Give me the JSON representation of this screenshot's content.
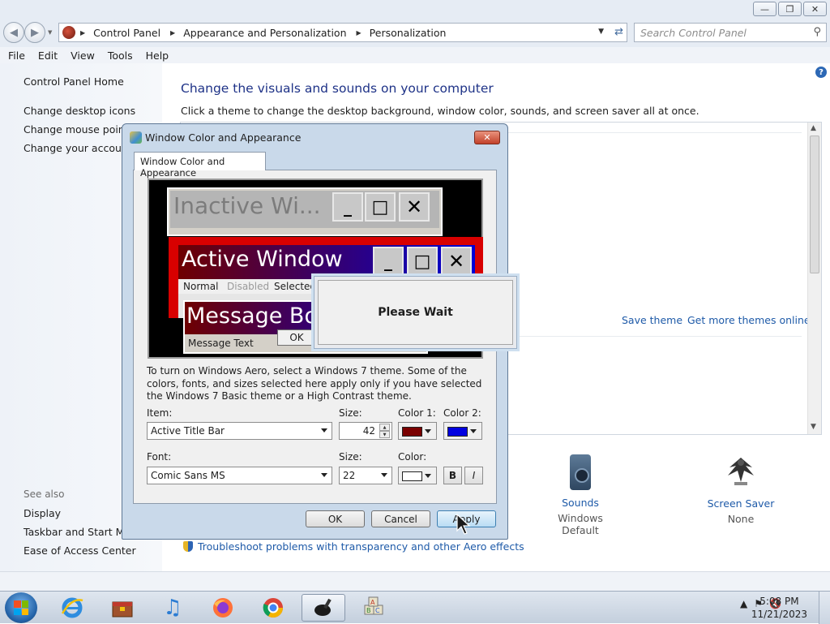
{
  "nav": {
    "breadcrumbs": [
      "Control Panel",
      "Appearance and Personalization",
      "Personalization"
    ],
    "search_placeholder": "Search Control Panel"
  },
  "menu": [
    "File",
    "Edit",
    "View",
    "Tools",
    "Help"
  ],
  "sidebar": {
    "home": "Control Panel Home",
    "links": [
      "Change desktop icons",
      "Change mouse pointers",
      "Change your account picture"
    ],
    "see_also_label": "See also",
    "see_also": [
      "Display",
      "Taskbar and Start Menu",
      "Ease of Access Center"
    ]
  },
  "main": {
    "heading": "Change the visuals and sounds on your computer",
    "subtext": "Click a theme to change the desktop background, window color, sounds, and screen saver all at once.",
    "save_theme": "Save theme",
    "get_more": "Get more themes online",
    "sounds_label": "Sounds",
    "sounds_value": "Windows Default",
    "saver_label": "Screen Saver",
    "saver_value": "None",
    "trouble_link": "Troubleshoot problems with transparency and other Aero effects"
  },
  "dialog": {
    "title": "Window Color and Appearance",
    "tab": "Window Color and Appearance",
    "preview": {
      "inactive_title": "Inactive Wi...",
      "active_title": "Active Window",
      "menu_normal": "Normal",
      "menu_disabled": "Disabled",
      "menu_selected": "Selected",
      "msg_title": "Message Bo",
      "msg_text": "Message Text",
      "msg_ok": "OK"
    },
    "info": "To turn on Windows Aero, select a Windows 7 theme.  Some of the colors, fonts, and sizes selected here apply only if you have selected the Windows 7 Basic theme or a High Contrast theme.",
    "item_label": "Item:",
    "item_value": "Active Title Bar",
    "size_label": "Size:",
    "size_value": "42",
    "color1_label": "Color 1:",
    "color2_label": "Color 2:",
    "color1": "#7a0000",
    "color2": "#0000e0",
    "font_label": "Font:",
    "font_value": "Comic Sans MS",
    "font_size_label": "Size:",
    "font_size_value": "22",
    "font_color_label": "Color:",
    "font_color": "#ffffff",
    "bold_label": "B",
    "italic_label": "I",
    "ok": "OK",
    "cancel": "Cancel",
    "apply": "Apply"
  },
  "wait": {
    "text": "Please Wait"
  },
  "taskbar": {
    "time": "5:08 PM",
    "date": "11/21/2023"
  },
  "colors": {
    "link": "#1e5aa8",
    "heading": "#1e3287",
    "title_gradient_start": "#6f0000",
    "title_gradient_end": "#0000d8"
  }
}
